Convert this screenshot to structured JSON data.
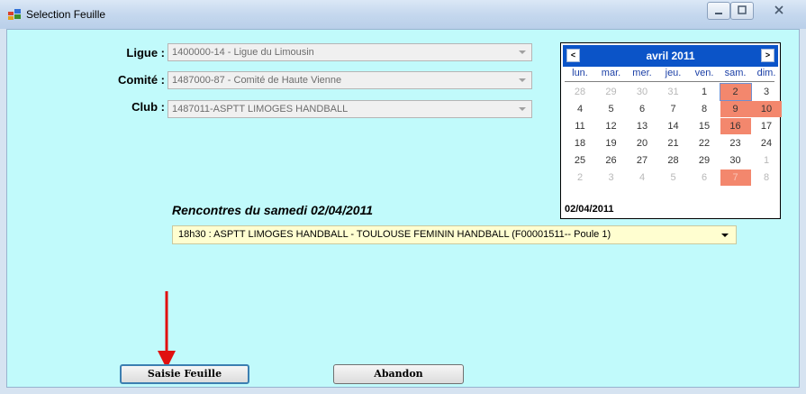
{
  "window": {
    "title": "Selection Feuille"
  },
  "labels": {
    "ligue": "Ligue :",
    "comite": "Comité :",
    "club": "Club :"
  },
  "combos": {
    "ligue": "1400000-14 - Ligue du Limousin",
    "comite": "1487000-87 - Comité de Haute Vienne",
    "club": "1487011-ASPTT LIMOGES HANDBALL"
  },
  "calendar": {
    "month": "avril 2011",
    "prev": "<",
    "next": ">",
    "dow": [
      "lun.",
      "mar.",
      "mer.",
      "jeu.",
      "ven.",
      "sam.",
      "dim."
    ],
    "weeks": [
      [
        "28",
        "29",
        "30",
        "31",
        "1",
        "2",
        "3"
      ],
      [
        "4",
        "5",
        "6",
        "7",
        "8",
        "9",
        "10"
      ],
      [
        "11",
        "12",
        "13",
        "14",
        "15",
        "16",
        "17"
      ],
      [
        "18",
        "19",
        "20",
        "21",
        "22",
        "23",
        "24"
      ],
      [
        "25",
        "26",
        "27",
        "28",
        "29",
        "30",
        "1"
      ],
      [
        "2",
        "3",
        "4",
        "5",
        "6",
        "7",
        "8"
      ]
    ],
    "today": "02/04/2011",
    "colors": {
      "header": "#0b54c8",
      "highlight": "#f3876d"
    }
  },
  "rencontres": {
    "title": "Rencontres du samedi  02/04/2011",
    "selected": "18h30 :  ASPTT LIMOGES HANDBALL - TOULOUSE FEMININ HANDBALL (F00001511-- Poule 1)"
  },
  "buttons": {
    "saisie": "Saisie Feuille",
    "abandon": "Abandon"
  }
}
